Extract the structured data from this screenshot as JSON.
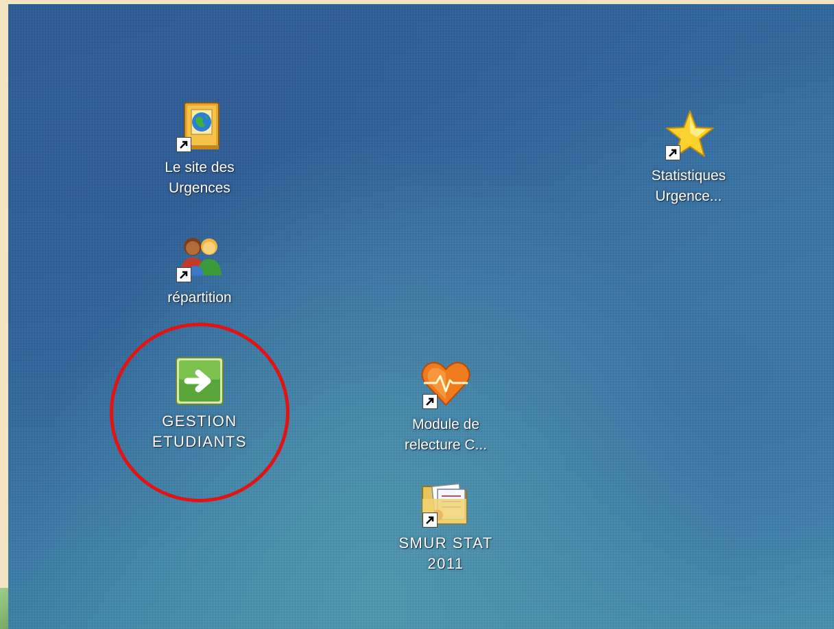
{
  "desktop": {
    "icons": [
      {
        "id": "site-urgences",
        "label": "Le site des\nUrgences",
        "icon": "globe-book-icon",
        "shortcut": true
      },
      {
        "id": "repartition",
        "label": "répartition",
        "icon": "users-icon",
        "shortcut": true
      },
      {
        "id": "gestion-etudiants",
        "label": "GESTION\nETUDIANTS",
        "icon": "green-arrow-icon",
        "shortcut": false,
        "highlighted": true
      },
      {
        "id": "module-relecture",
        "label": "Module de\nrelecture C...",
        "icon": "heart-pulse-icon",
        "shortcut": true
      },
      {
        "id": "smur-stat",
        "label": "SMUR STAT\n2011",
        "icon": "folder-documents-icon",
        "shortcut": true
      },
      {
        "id": "statistiques-urgence",
        "label": "Statistiques\nUrgence...",
        "icon": "star-icon",
        "shortcut": true
      }
    ]
  },
  "colors": {
    "highlight_ring": "#e11414",
    "desktop_blue": "#33689d",
    "label_text": "#ffffff"
  }
}
